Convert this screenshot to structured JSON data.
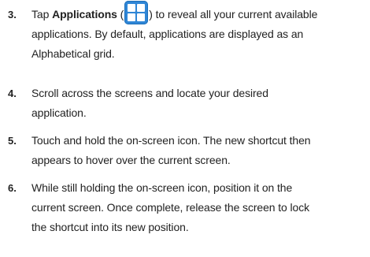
{
  "steps": [
    {
      "number": "3.",
      "line1": {
        "before": "Tap ",
        "bold": "Applications",
        "after_open": " (",
        "after_close": ") to reveal all your current available"
      },
      "lines": [
        "applications. By default, applications are displayed as an",
        "Alphabetical grid."
      ],
      "icon": "applications-grid-icon"
    },
    {
      "number": "4.",
      "lines": [
        "Scroll across the screens and locate your desired",
        "application."
      ]
    },
    {
      "number": "5.",
      "lines": [
        "Touch and hold the on-screen icon. The new shortcut then",
        "appears to hover over the current screen."
      ]
    },
    {
      "number": "6.",
      "lines": [
        "While still holding the on-screen icon, position it on the",
        "current screen. Once complete, release the screen to lock",
        "the shortcut into its new position."
      ]
    }
  ],
  "colors": {
    "text": "#222222",
    "icon_bg": "#2f86d6",
    "icon_fg": "#ffffff"
  }
}
